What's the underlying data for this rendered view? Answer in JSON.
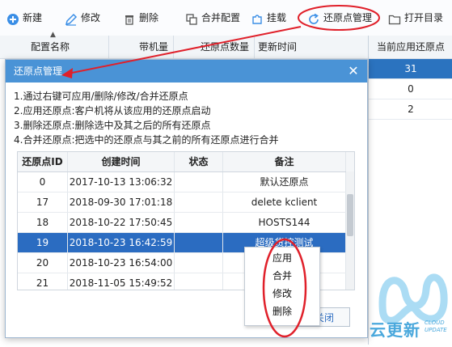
{
  "toolbar": {
    "new": "新建",
    "edit": "修改",
    "delete": "删除",
    "merge_config": "合并配置",
    "mount": "挂载",
    "restore_manage": "还原点管理",
    "open_dir": "打开目录"
  },
  "grid": {
    "headers": [
      "配置名称",
      "带机量",
      "还原点数量",
      "更新时间"
    ],
    "right_header": "当前应用还原点",
    "right_values": [
      "31",
      "0",
      "2"
    ]
  },
  "dialog": {
    "title": "还原点管理",
    "desc": [
      "1.通过右键可应用/删除/修改/合并还原点",
      "2.应用还原点:客户机将从该应用的还原点启动",
      "3.删除还原点:删除选中及其之后的所有还原点",
      "4.合并还原点:把选中的还原点与其之前的所有还原点进行合并"
    ],
    "table_headers": [
      "还原点ID",
      "创建时间",
      "状态",
      "备注"
    ],
    "rows": [
      {
        "id": "0",
        "time": "2017-10-13 13:06:32",
        "status": "",
        "note": "默认还原点"
      },
      {
        "id": "17",
        "time": "2018-09-30 17:01:18",
        "status": "",
        "note": "delete kclient"
      },
      {
        "id": "18",
        "time": "2018-10-22 17:50:45",
        "status": "",
        "note": "HOSTS144"
      },
      {
        "id": "19",
        "time": "2018-10-23 16:42:59",
        "status": "",
        "note": "超级货控测试"
      },
      {
        "id": "20",
        "time": "2018-10-23 16:54:00",
        "status": "",
        "note": ""
      },
      {
        "id": "21",
        "time": "2018-11-05 15:49:52",
        "status": "",
        "note": ""
      }
    ],
    "close_label": "关闭"
  },
  "context_menu": [
    "应用",
    "合并",
    "修改",
    "删除"
  ],
  "watermark": {
    "cn": "云更新",
    "en1": "CLOUD",
    "en2": "UPDATE"
  },
  "colors": {
    "title_bar": "#4a93d6",
    "selection": "#2b6cc1",
    "annotation": "#e0202a"
  }
}
